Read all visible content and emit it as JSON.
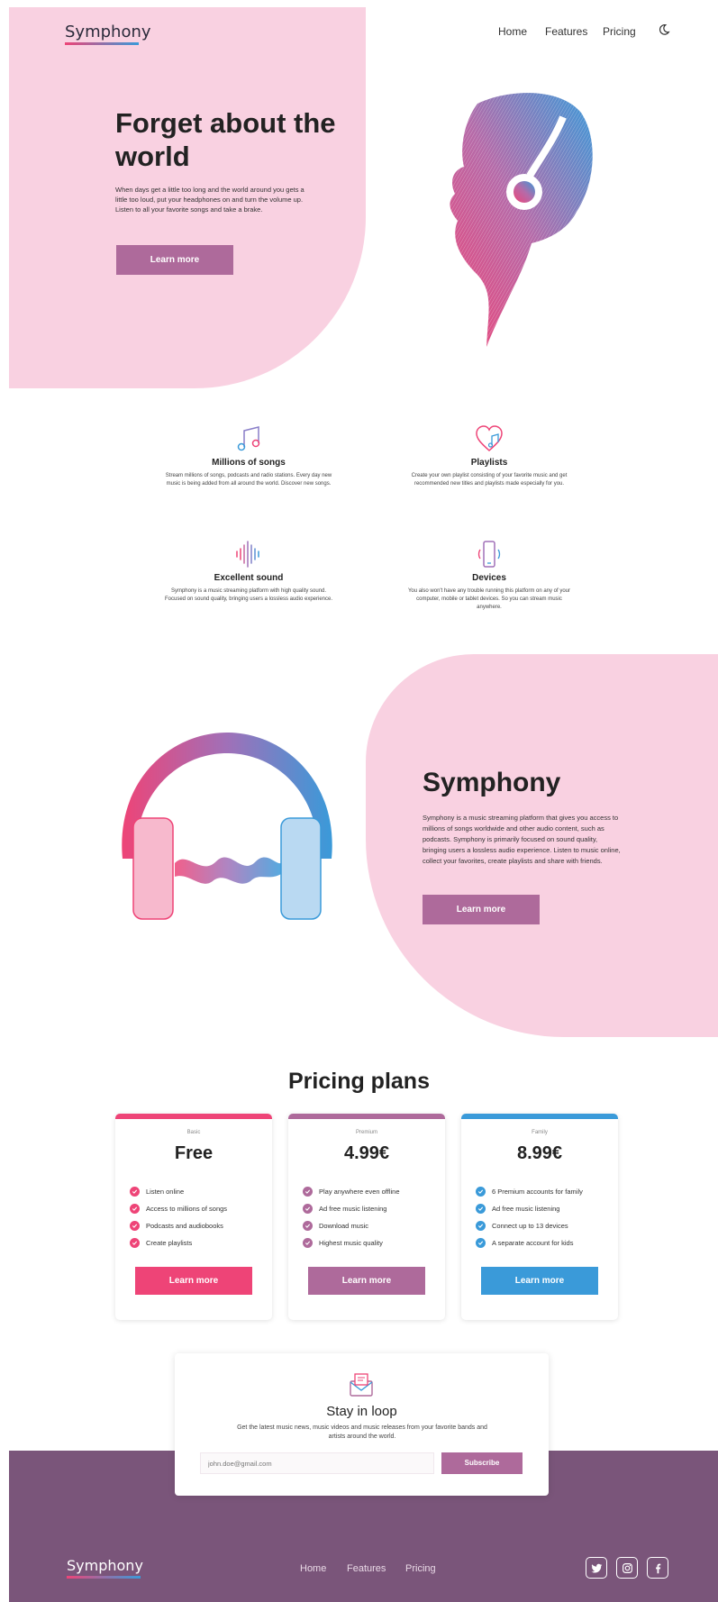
{
  "brand": {
    "name": "Symphony",
    "pink": "#f9d1e1",
    "purple": "#ae6a9b",
    "red": "#ee4477",
    "blue": "#3a9ad9",
    "footer": "#7a557a"
  },
  "nav": {
    "links": [
      "Home",
      "Features",
      "Pricing"
    ],
    "theme_icon": "moon-icon"
  },
  "hero": {
    "title": "Forget about the world",
    "text": "When days get a little too long and the world around you gets a little too loud, put your headphones on and turn the volume up. Listen to all your favorite songs and take a brake.",
    "button": "Learn more"
  },
  "features": [
    {
      "icon": "music-note-icon",
      "title": "Millions of songs",
      "text": "Stream millions of songs, podcasts and radio stations. Every day new music is being added from all around the world. Discover new songs."
    },
    {
      "icon": "heart-music-icon",
      "title": "Playlists",
      "text": "Create your own playlist consisting of your favorite music and get recommended new titles and playlists made especially for you."
    },
    {
      "icon": "sound-wave-icon",
      "title": "Excellent sound",
      "text": "Symphony is a music streaming platform with high quality sound. Focused on sound quality, bringing users a lossless audio experience."
    },
    {
      "icon": "phone-icon",
      "title": "Devices",
      "text": "You also won't have any trouble running this platform on any of your computer, mobile or tablet devices. So you can stream music anywhere."
    }
  ],
  "about": {
    "title": "Symphony",
    "text": "Symphony is a music streaming platform that gives you access to millions of songs worldwide and other audio content, such as podcasts. Symphony is primarily focused on sound quality, bringing users a lossless audio experience. Listen to music online, collect your favorites, create playlists and share with friends.",
    "button": "Learn more"
  },
  "pricing": {
    "title": "Pricing plans",
    "plans": [
      {
        "tier": "Basic",
        "price": "Free",
        "color": "#ee4477",
        "features": [
          "Listen online",
          "Access to millions of songs",
          "Podcasts and audiobooks",
          "Create playlists"
        ],
        "button": "Learn more"
      },
      {
        "tier": "Premium",
        "price": "4.99€",
        "color": "#ae6a9b",
        "features": [
          "Play anywhere even offline",
          "Ad free music listening",
          "Download music",
          "Highest music quality"
        ],
        "button": "Learn more"
      },
      {
        "tier": "Family",
        "price": "8.99€",
        "color": "#3a9ad9",
        "features": [
          "6 Premium accounts for family",
          "Ad free music listening",
          "Connect up to 13 devices",
          "A separate account for kids"
        ],
        "button": "Learn more"
      }
    ]
  },
  "newsletter": {
    "icon": "envelope-icon",
    "title": "Stay in loop",
    "text": "Get the latest music news, music videos and music releases from your favorite bands and artists around the world.",
    "placeholder": "john.doe@gmail.com",
    "button": "Subscribe"
  },
  "footer": {
    "logo": "Symphony",
    "links": [
      "Home",
      "Features",
      "Pricing"
    ],
    "social": [
      "twitter-icon",
      "instagram-icon",
      "facebook-icon"
    ]
  }
}
